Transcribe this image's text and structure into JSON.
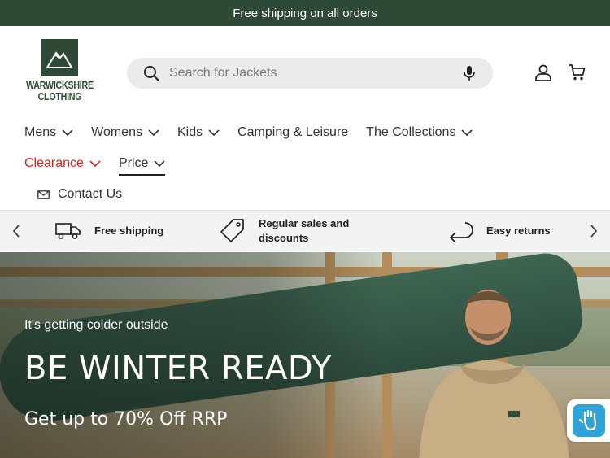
{
  "announcement": "Free shipping on all orders",
  "logo": {
    "line1": "WARWICKSHIRE",
    "line2": "CLOTHING"
  },
  "search": {
    "placeholder": "Search for Jackets"
  },
  "nav": {
    "items": [
      {
        "label": "Mens",
        "dropdown": true
      },
      {
        "label": "Womens",
        "dropdown": true
      },
      {
        "label": "Kids",
        "dropdown": true
      },
      {
        "label": "Camping & Leisure",
        "dropdown": false
      },
      {
        "label": "The Collections",
        "dropdown": true
      }
    ],
    "row2": [
      {
        "label": "Clearance",
        "dropdown": true
      },
      {
        "label": "Price",
        "dropdown": true
      }
    ],
    "contact": "Contact Us"
  },
  "usp": {
    "items": [
      {
        "label": "Free shipping",
        "icon": "truck-icon"
      },
      {
        "label_line1": "Regular sales and",
        "label_line2": "discounts",
        "icon": "tag-icon"
      },
      {
        "label": "Easy returns",
        "icon": "return-arrow-icon"
      }
    ]
  },
  "hero": {
    "kicker": "It's getting colder outside",
    "title": "BE WINTER READY",
    "subtitle": "Get up to 70% Off RRP"
  },
  "colors": {
    "brand": "#2e4a36",
    "clearance": "#d8241c",
    "accessibility": "#2fa3d8"
  }
}
